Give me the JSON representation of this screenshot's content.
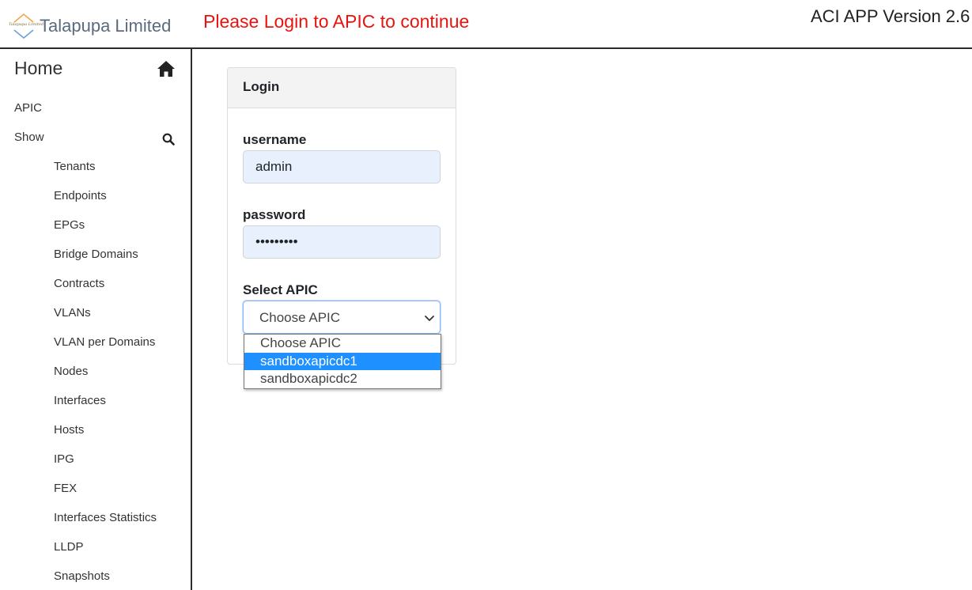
{
  "header": {
    "brand_name": "Talapupa Limited",
    "brand_logo_text": "Talapupa Limited",
    "login_alert": "Please Login to APIC to continue",
    "app_version": "ACI APP Version 2.6",
    "alert_color": "#e8130f"
  },
  "sidebar": {
    "home_label": "Home",
    "home_icon": "home-icon",
    "apic_label": "APIC",
    "show_label": "Show",
    "search_icon": "search-icon",
    "show_items": [
      "Tenants",
      "Endpoints",
      "EPGs",
      "Bridge Domains",
      "Contracts",
      "VLANs",
      "VLAN per Domains",
      "Nodes",
      "Interfaces",
      "Hosts",
      "IPG",
      "FEX",
      "Interfaces Statistics",
      "LLDP",
      "Snapshots"
    ]
  },
  "login": {
    "title": "Login",
    "username_label": "username",
    "username_value": "admin",
    "password_label": "password",
    "password_value": "•••••••••",
    "select_label": "Select APIC",
    "select_value": "Choose APIC",
    "options": [
      "Choose APIC",
      "sandboxapicdc1",
      "sandboxapicdc2"
    ],
    "highlighted_option": "sandboxapicdc1",
    "highlight_color": "#1e90ff",
    "input_autofill_color": "#e8f0fe"
  }
}
